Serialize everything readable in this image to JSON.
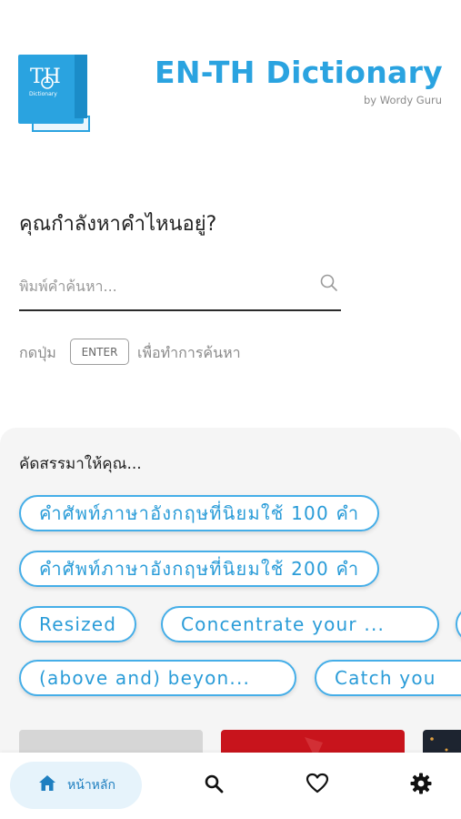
{
  "header": {
    "logo_letters": "TH",
    "logo_caption": "Dictionary",
    "title": "EN-TH Dictionary",
    "subtitle": "by Wordy Guru"
  },
  "search": {
    "question": "คุณกำลังหาคำไหนอยู่?",
    "placeholder": "พิมพ์คำค้นหา...",
    "hint_prefix": "กดปุ่ม",
    "hint_key": "ENTER",
    "hint_suffix": "เพื่อทำการค้นหา"
  },
  "recommend": {
    "title": "คัดสรรมาให้คุณ...",
    "chips": [
      "คำศัพท์ภาษาอังกฤษที่นิยมใช้ 100 คำ",
      "คำศัพท์ภาษาอังกฤษที่นิยมใช้ 200 คำ",
      "Resized",
      "Concentrate your ...",
      "(above and) beyon...",
      "Catch you"
    ]
  },
  "nav": {
    "home_label": "หน้าหลัก",
    "items": [
      "home-icon",
      "search-icon",
      "heart-icon",
      "gear-icon"
    ],
    "accent": "#2aa3e0"
  },
  "colors": {
    "brand": "#2aa3e0",
    "chip_border": "#45aee8",
    "card_red": "#c8141c",
    "card_gray": "#d6d6d6"
  }
}
